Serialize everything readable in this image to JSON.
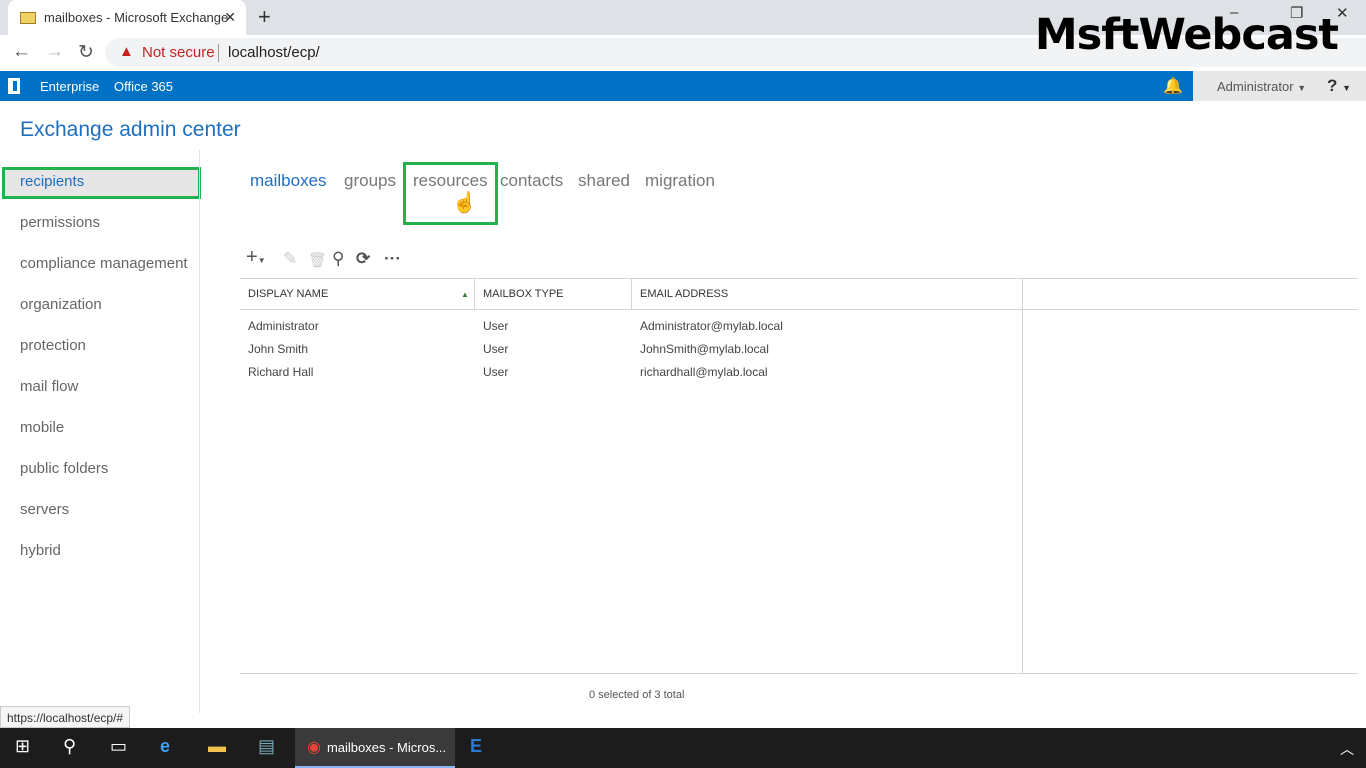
{
  "browser": {
    "tab_title": "mailboxes - Microsoft Exchange",
    "security": "Not secure",
    "url": "localhost/ecp/",
    "status_url": "https://localhost/ecp/#"
  },
  "watermark": "MsftWebcast",
  "suitebar": {
    "links": [
      "Enterprise",
      "Office 365"
    ],
    "user": "Administrator",
    "help": "?"
  },
  "app_title": "Exchange admin center",
  "sidebar": {
    "items": [
      {
        "label": "recipients",
        "selected": true
      },
      {
        "label": "permissions"
      },
      {
        "label": "compliance management"
      },
      {
        "label": "organization"
      },
      {
        "label": "protection"
      },
      {
        "label": "mail flow"
      },
      {
        "label": "mobile"
      },
      {
        "label": "public folders"
      },
      {
        "label": "servers"
      },
      {
        "label": "hybrid"
      }
    ]
  },
  "subtabs": [
    {
      "label": "mailboxes",
      "active": true
    },
    {
      "label": "groups"
    },
    {
      "label": "resources",
      "highlighted": true
    },
    {
      "label": "contacts"
    },
    {
      "label": "shared"
    },
    {
      "label": "migration"
    }
  ],
  "toolbar": [
    "add-icon",
    "edit-icon",
    "delete-icon",
    "search-icon",
    "refresh-icon",
    "more-icon"
  ],
  "table": {
    "columns": [
      "DISPLAY NAME",
      "MAILBOX TYPE",
      "EMAIL ADDRESS"
    ],
    "sort": "DISPLAY NAME ascending",
    "rows": [
      [
        "Administrator",
        "User",
        "Administrator@mylab.local"
      ],
      [
        "John Smith",
        "User",
        "JohnSmith@mylab.local"
      ],
      [
        "Richard Hall",
        "User",
        "richardhall@mylab.local"
      ]
    ]
  },
  "footer": "0 selected of 3 total",
  "taskbar": {
    "active_window": "mailboxes - Micros..."
  },
  "colors": {
    "suitebar": "#0072c6",
    "highlight": "#22b14c",
    "accent": "#1f6fbf"
  }
}
